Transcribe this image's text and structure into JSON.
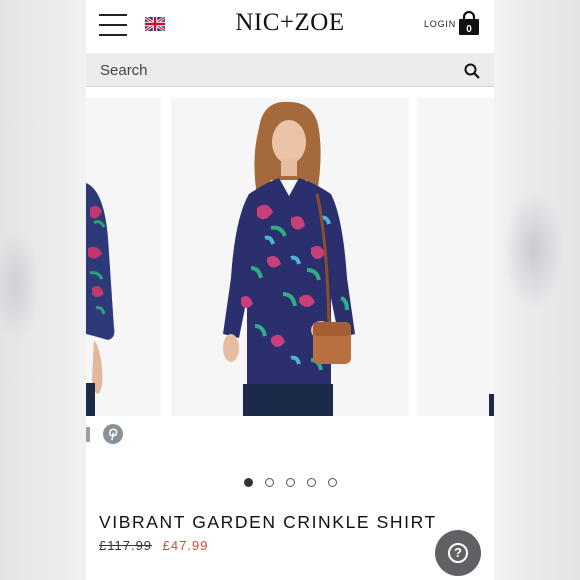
{
  "header": {
    "brand": "NIC+ZOE",
    "login_label": "LOGIN",
    "cart_count": "0",
    "region_flag": "uk-flag"
  },
  "search": {
    "placeholder": "Search"
  },
  "carousel": {
    "slides": 5,
    "active_index": 0
  },
  "product": {
    "name": "VIBRANT GARDEN CRINKLE SHIRT",
    "original_price": "£117.99",
    "sale_price": "£47.99"
  },
  "colors": {
    "sale_red": "#d24a3a",
    "help_button": "#5f6164",
    "search_bg": "#ececef"
  },
  "icons": [
    "menu-icon",
    "uk-flag-icon",
    "shopping-bag-icon",
    "search-icon",
    "pinterest-icon",
    "help-icon"
  ]
}
